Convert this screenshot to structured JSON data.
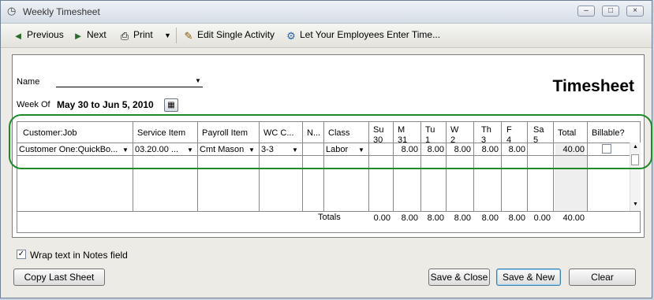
{
  "window": {
    "title": "Weekly Timesheet"
  },
  "toolbar": {
    "previous": "Previous",
    "next": "Next",
    "print": "Print",
    "edit_single": "Edit Single Activity",
    "let_employees": "Let Your Employees Enter Time..."
  },
  "form": {
    "name_label": "Name",
    "name_value": "",
    "week_of_label": "Week Of",
    "week_range": "May 30 to Jun 5, 2010",
    "title": "Timesheet"
  },
  "grid": {
    "headers": {
      "customer_job": "Customer:Job",
      "service_item": "Service Item",
      "payroll_item": "Payroll Item",
      "wc_code": "WC C...",
      "notes": "N...",
      "class": "Class",
      "su": "Su",
      "su_d": "30",
      "m": "M",
      "m_d": "31",
      "tu": "Tu",
      "tu_d": "1",
      "w": "W",
      "w_d": "2",
      "th": "Th",
      "th_d": "3",
      "f": "F",
      "f_d": "4",
      "sa": "Sa",
      "sa_d": "5",
      "total": "Total",
      "billable": "Billable?"
    },
    "row1": {
      "customer_job": "Customer One:QuickBo...",
      "service_item": "03.20.00 ...",
      "payroll_item": "Cmt Mason",
      "wc_code": "3-3",
      "notes": "",
      "class": "Labor",
      "su": "",
      "m": "8.00",
      "tu": "8.00",
      "w": "8.00",
      "th": "8.00",
      "f": "8.00",
      "sa": "",
      "total": "40.00",
      "billable": false
    },
    "totals": {
      "label": "Totals",
      "su": "0.00",
      "m": "8.00",
      "tu": "8.00",
      "w": "8.00",
      "th": "8.00",
      "f": "8.00",
      "sa": "0.00",
      "total": "40.00"
    }
  },
  "options": {
    "wrap_text_label": "Wrap text in Notes field",
    "wrap_text_checked": true
  },
  "buttons": {
    "copy_last": "Copy Last Sheet",
    "save_close": "Save & Close",
    "save_new": "Save & New",
    "clear": "Clear"
  }
}
